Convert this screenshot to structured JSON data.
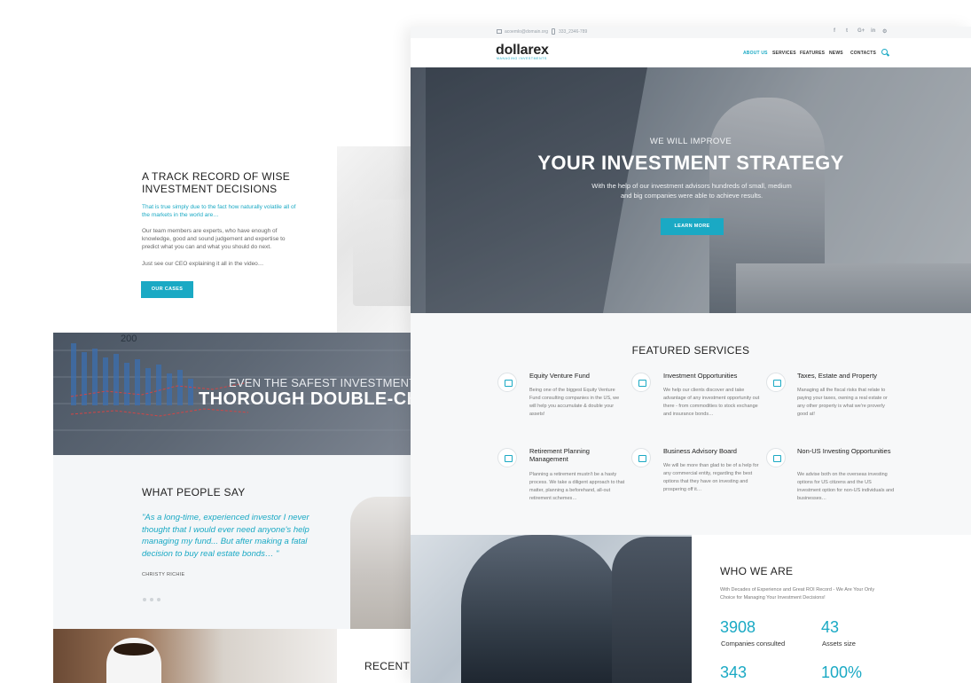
{
  "back_page": {
    "track_record": {
      "title": "A TRACK RECORD OF WISE INVESTMENT DECISIONS",
      "lead": "That is true simply due to the fact how naturally volatile all of the markets in the world are…",
      "body": "Our team members are experts, who have enough of knowledge, good and sound judgement and expertise to predict what you can and what you should do next.",
      "ceo_line": "Just see our CEO explaining it all in the video…",
      "button_label": "OUR CASES"
    },
    "banner": {
      "chart_tick": "200",
      "subtitle": "EVEN THE SAFEST INVESTMENT BETS R",
      "title": "THOROUGH DOUBLE-CHEC"
    },
    "testimonials": {
      "title": "WHAT PEOPLE SAY",
      "quote": "\"As a long-time, experienced investor I never thought that I would ever need anyone's help managing my fund... But after making a fatal decision to buy real estate bonds… \"",
      "author": "CHRISTY RICHIE"
    },
    "recent": {
      "title": "RECENT B"
    }
  },
  "front_page": {
    "topbar": {
      "email": "acoemlo@domain.org",
      "phone": "333_2346-789",
      "social": [
        "f",
        "t",
        "G+",
        "in",
        "⚙"
      ]
    },
    "logo": {
      "name": "dollarex",
      "tagline": "MANAGING INVESTMENTS"
    },
    "nav": {
      "items": [
        {
          "label": "ABOUT US",
          "active": true
        },
        {
          "label": "SERVICES",
          "active": false
        },
        {
          "label": "FEATURES",
          "active": false
        },
        {
          "label": "NEWS",
          "active": false
        },
        {
          "label": "CONTACTS",
          "active": false
        }
      ],
      "search_icon": "search-icon"
    },
    "hero": {
      "subtitle": "WE WILL IMPROVE",
      "title": "YOUR INVESTMENT STRATEGY",
      "description": "With the help of our investment advisors hundreds of small, medium and big companies were able to achieve results.",
      "button_label": "LEARN MORE"
    },
    "services": {
      "title": "FEATURED SERVICES",
      "items": [
        {
          "title": "Equity Venture Fund",
          "text": "Being one of the biggest Equity Venture Fund consulting companies in the US, we will help you accumulate & double your assets!",
          "icon": "coins-icon"
        },
        {
          "title": "Investment Opportunities",
          "text": "We help our clients discover and take advantage of any investment opportunity out there - from commodities to stock exchange and insurance bonds…",
          "icon": "hand-pointer-icon"
        },
        {
          "title": "Taxes, Estate and Property",
          "text": "Managing all the fiscal risks that relate to paying your taxes, owning a real estate or any other property is what we're proverly good at!",
          "icon": "house-icon"
        },
        {
          "title": "Retirement Planning Management",
          "text": "Planning a retirement mustn't be a hasty process. We take a diligent approach to that matter, planning a beforehand, all-out  retirement schemes…",
          "icon": "briefcase-icon"
        },
        {
          "title": "Business Advisory Board",
          "text": "We will be more than glad to be of a help for any commercial entity, regarding the best options that they have on investing and prospering off it…",
          "icon": "chart-icon"
        },
        {
          "title": "Non-US Investing Opportunities",
          "text": "We advise both on the overseas investing options for US citizens and the US investment option for non-US individuals and businesses…",
          "icon": "globe-pin-icon"
        }
      ]
    },
    "who_we_are": {
      "title": "WHO WE ARE",
      "text": "With Decades of Experience and Great ROI Record - We Are Your Only Choice for Managing Your Investment Decisions!",
      "stats": [
        {
          "value": "3908",
          "label": "Companies consulted"
        },
        {
          "value": "43",
          "label": "Assets size"
        },
        {
          "value": "343",
          "label": ""
        },
        {
          "value": "100%",
          "label": ""
        }
      ]
    },
    "accent_color": "#1aa9c4"
  }
}
